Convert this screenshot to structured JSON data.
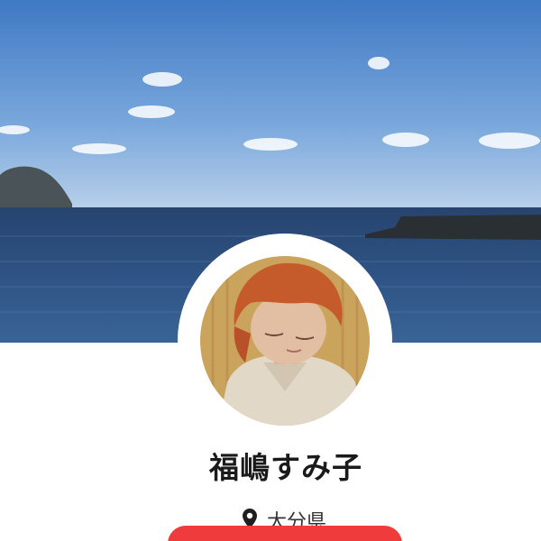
{
  "profile": {
    "name": "福嶋すみ子",
    "location": "大分県"
  },
  "icons": {
    "location": "location-pin-icon"
  },
  "colors": {
    "accent": "#ef3b3b",
    "name_text": "#1a1a1a",
    "location_text": "#333333"
  }
}
